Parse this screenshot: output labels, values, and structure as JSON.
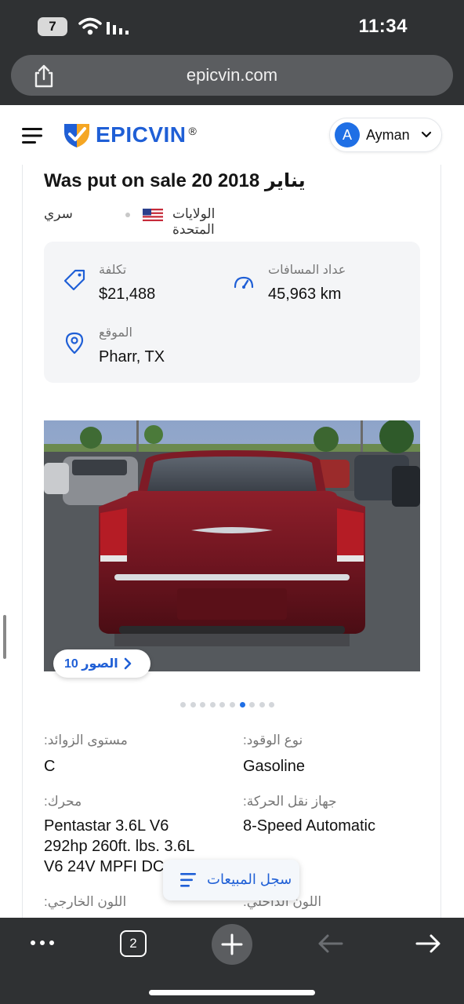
{
  "status_bar": {
    "battery": "7",
    "time": "11:34"
  },
  "browser": {
    "url": "epicvin.com",
    "tabs_count": "2"
  },
  "header": {
    "logo_text": "EPICVIN",
    "logo_reg": "®",
    "avatar_letter": "A",
    "user_name": "Ayman"
  },
  "listing": {
    "title": "Was put on sale 20 2018 يناير",
    "condition": "سري",
    "country": "الولايات المتحدة",
    "price_label": "تكلفة",
    "price_value": "$21,488",
    "odometer_label": "عداد المسافات",
    "odometer_value": "45,963 km",
    "location_label": "الموقع",
    "location_value": "Pharr, TX",
    "photos_button": "الصور 10",
    "photo_count": 10,
    "active_photo_index": 7
  },
  "specs": {
    "trim_label": ":مستوى الزوائد",
    "trim_value": "C",
    "fuel_label": ":نوع الوقود",
    "fuel_value": "Gasoline",
    "engine_label": ":محرك",
    "engine_value": "Pentastar 3.6L V6 292hp 260ft. lbs. 3.6L V6 24V MPFI DC",
    "transmission_label": ":جهاز نقل الحركة",
    "transmission_value": "8-Speed Automatic",
    "exterior_label": ":اللون الخارجي",
    "interior_label": ":اللون الداخلي"
  },
  "floating": {
    "sales_history": "سجل المبيعات"
  },
  "colors": {
    "brand_blue": "#1f5fd6",
    "chrome_dark": "#2f3133",
    "car_red": "#7a1620"
  }
}
